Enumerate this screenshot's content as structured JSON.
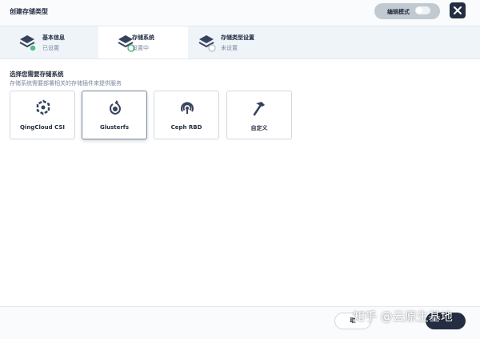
{
  "dialog": {
    "title": "创建存储类型",
    "edit_mode_label": "编辑模式",
    "close_icon": "close-icon"
  },
  "steps": [
    {
      "title": "基本信息",
      "status": "已设置",
      "state": "done"
    },
    {
      "title": "存储系统",
      "status": "设置中",
      "state": "active"
    },
    {
      "title": "存储类型设置",
      "status": "未设置",
      "state": "pending"
    }
  ],
  "section": {
    "title": "选择您需要存储系统",
    "description": "存储系统需要部署相关的存储插件来提供服务"
  },
  "cards": [
    {
      "label": "QingCloud CSI",
      "icon": "qingcloud-icon"
    },
    {
      "label": "Glusterfs",
      "icon": "glusterfs-icon",
      "selected": true
    },
    {
      "label": "Ceph RBD",
      "icon": "ceph-icon"
    },
    {
      "label": "自定义",
      "icon": "hammer-icon"
    }
  ],
  "footer": {
    "cancel_label": "取",
    "next_label": ""
  },
  "watermark": "知乎 @云原生基地",
  "colors": {
    "primary_dark": "#242e42",
    "step_done": "#55bc8a",
    "muted_text": "#79879c",
    "border": "#d1d7e0"
  }
}
